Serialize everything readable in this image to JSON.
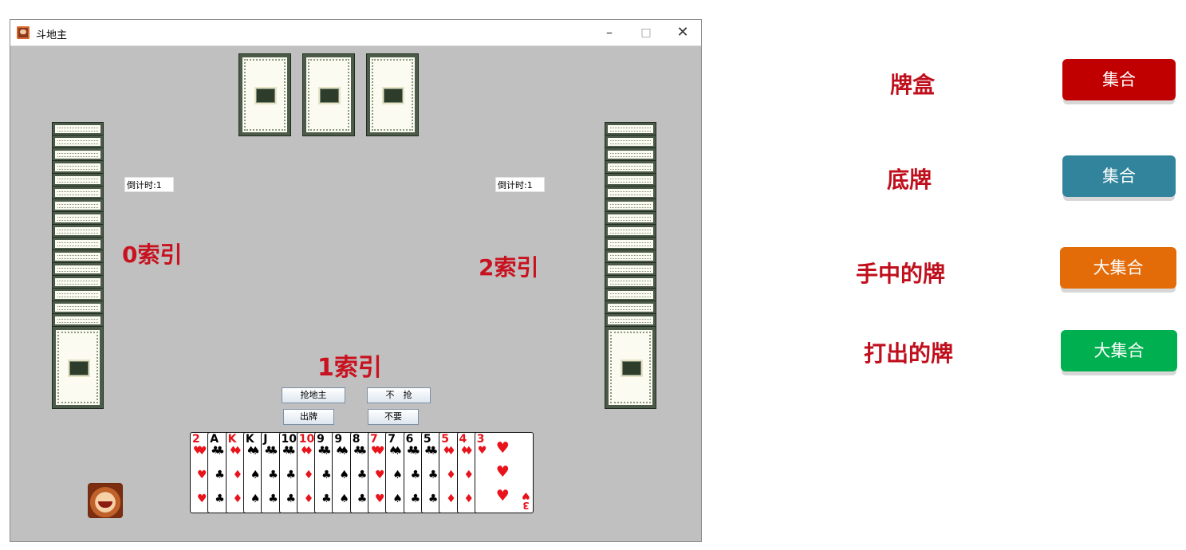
{
  "window": {
    "title": "斗地主",
    "controls": {
      "minimize": "–",
      "maximize": "□",
      "close": "✕"
    }
  },
  "game": {
    "timer_left": "倒计时:1",
    "timer_right": "倒计时:1",
    "buttons": {
      "grab_landlord": "抢地主",
      "not_grab": "不　抢",
      "play": "出牌",
      "pass": "不要"
    },
    "hand": [
      {
        "rank": "2",
        "suit": "♥",
        "color": "#e8131b"
      },
      {
        "rank": "A",
        "suit": "♣",
        "color": "#000000"
      },
      {
        "rank": "K",
        "suit": "♦",
        "color": "#e8131b"
      },
      {
        "rank": "K",
        "suit": "♠",
        "color": "#000000"
      },
      {
        "rank": "J",
        "suit": "♣",
        "color": "#000000"
      },
      {
        "rank": "10",
        "suit": "♣",
        "color": "#000000"
      },
      {
        "rank": "10",
        "suit": "♦",
        "color": "#e8131b"
      },
      {
        "rank": "9",
        "suit": "♣",
        "color": "#000000"
      },
      {
        "rank": "9",
        "suit": "♠",
        "color": "#000000"
      },
      {
        "rank": "8",
        "suit": "♣",
        "color": "#000000"
      },
      {
        "rank": "7",
        "suit": "♥",
        "color": "#e8131b"
      },
      {
        "rank": "7",
        "suit": "♠",
        "color": "#000000"
      },
      {
        "rank": "6",
        "suit": "♣",
        "color": "#000000"
      },
      {
        "rank": "5",
        "suit": "♣",
        "color": "#000000"
      },
      {
        "rank": "5",
        "suit": "♦",
        "color": "#e8131b"
      },
      {
        "rank": "4",
        "suit": "♦",
        "color": "#e8131b"
      },
      {
        "rank": "3",
        "suit": "♥",
        "color": "#e8131b"
      }
    ]
  },
  "annotations": {
    "index_0": "0索引",
    "index_1": "1索引",
    "index_2": "2索引"
  },
  "legend": [
    {
      "label": "牌盒",
      "button": "集合",
      "color": "#c00000"
    },
    {
      "label": "底牌",
      "button": "集合",
      "color": "#31849b"
    },
    {
      "label": "手中的牌",
      "button": "大集合",
      "color": "#e36c09"
    },
    {
      "label": "打出的牌",
      "button": "大集合",
      "color": "#00b050"
    }
  ]
}
